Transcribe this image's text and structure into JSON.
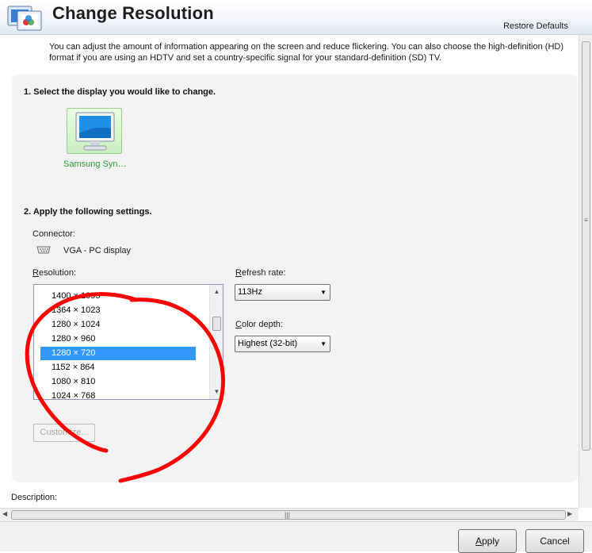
{
  "header": {
    "title": "Change Resolution",
    "restore_defaults": "Restore Defaults"
  },
  "intro_text": "You can adjust the amount of information appearing on the screen and reduce flickering. You can also choose the high-definition (HD) format if you are using an HDTV and set a country-specific signal for your standard-definition (SD) TV.",
  "section1": {
    "title": "1. Select the display you would like to change.",
    "display_name": "Samsung Syn…"
  },
  "section2": {
    "title": "2. Apply the following settings.",
    "connector_label": "Connector:",
    "connector_value": "VGA - PC display",
    "resolution_label": "Resolution:",
    "resolutions": [
      "1400 × 1095",
      "1364 × 1023",
      "1280 × 1024",
      "1280 × 960",
      "1280 × 720",
      "1152 × 864",
      "1080 × 810",
      "1024 × 768"
    ],
    "selected_resolution": "1280 × 720",
    "refresh_rate_label": "Refresh rate:",
    "refresh_rate_value": "113Hz",
    "color_depth_label": "Color depth:",
    "color_depth_value": "Highest (32-bit)",
    "customize_label": "Customize..."
  },
  "description_label": "Description:",
  "footer": {
    "apply_label": "Apply",
    "cancel_label": "Cancel"
  },
  "colors": {
    "selection": "#3399ff",
    "display_label": "#2e9b34",
    "annotation_stroke": "#ff0000"
  }
}
